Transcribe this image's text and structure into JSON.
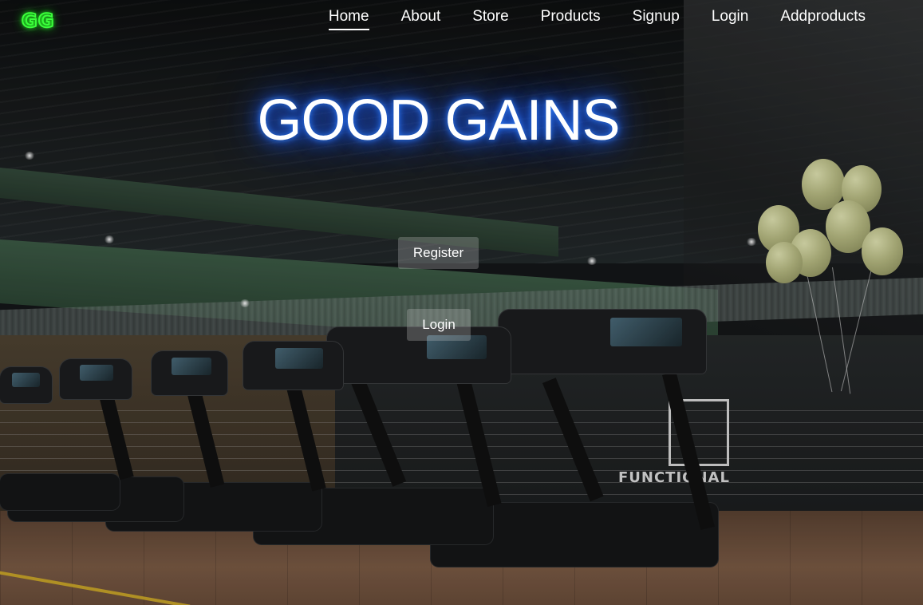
{
  "logo": {
    "text": "GG",
    "color": "#3bff3b"
  },
  "nav": {
    "items": [
      {
        "label": "Home",
        "active": true
      },
      {
        "label": "About",
        "active": false
      },
      {
        "label": "Store",
        "active": false
      },
      {
        "label": "Products",
        "active": false
      },
      {
        "label": "Signup",
        "active": false
      },
      {
        "label": "Login",
        "active": false
      },
      {
        "label": "Addproducts",
        "active": false
      }
    ]
  },
  "hero": {
    "title": "GOOD GAINS",
    "glow_color": "#1f63ff",
    "register_label": "Register",
    "login_label": "Login"
  },
  "background": {
    "sign_text": "FUNCTIONAL"
  }
}
